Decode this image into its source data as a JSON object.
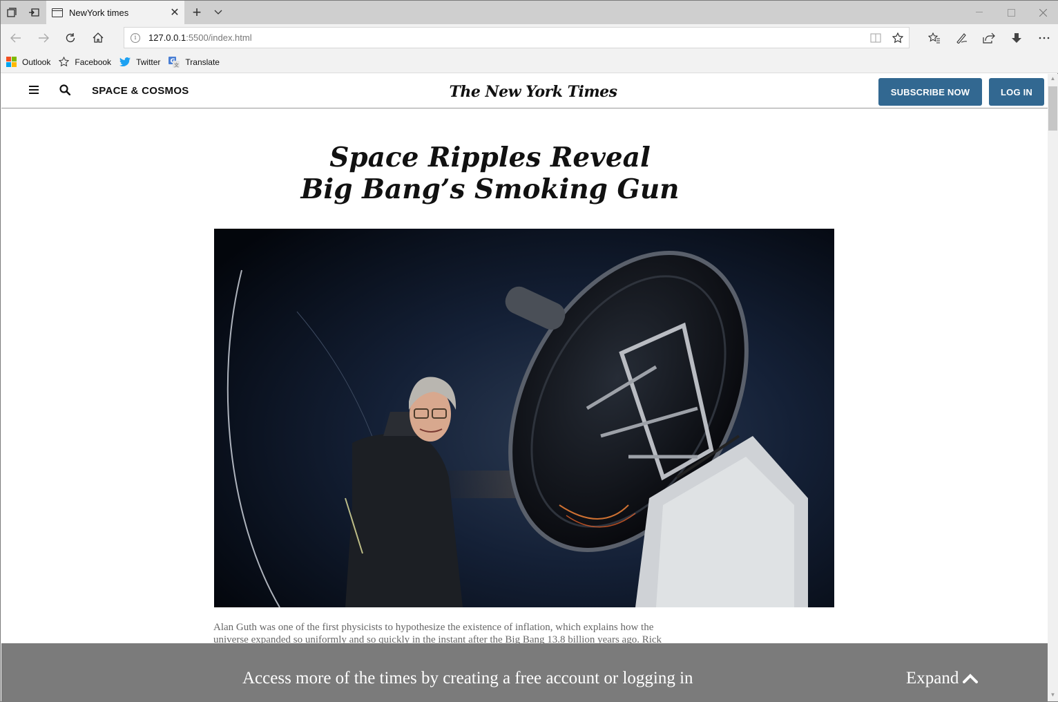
{
  "browser": {
    "tab_title": "NewYork times",
    "url_host": "127.0.0.1",
    "url_rest": ":5500/index.html",
    "favorites": [
      {
        "label": "Outlook",
        "icon": "outlook-icon"
      },
      {
        "label": "Facebook",
        "icon": "star-icon"
      },
      {
        "label": "Twitter",
        "icon": "twitter-icon"
      },
      {
        "label": "Translate",
        "icon": "translate-icon"
      }
    ]
  },
  "site": {
    "section_label": "SPACE & COSMOS",
    "logo_text": "The New York Times",
    "subscribe_label": "SUBSCRIBE NOW",
    "login_label": "LOG IN"
  },
  "article": {
    "headline_line1": "Space Ripples Reveal",
    "headline_line2": "Big Bang’s Smoking Gun",
    "caption_line1": "Alan Guth was one of the first physicists to hypothesize the existence of inflation, which explains how the",
    "caption_line2": "universe expanded so uniformly and so quickly in the instant after the Big Bang 13.8 billion years ago. Rick"
  },
  "overlay": {
    "message": "Access more of the times by creating a free account or logging in",
    "expand_label": "Expand"
  },
  "colors": {
    "brand_button": "#326891",
    "overlay_bg": "#7b7b7b"
  }
}
